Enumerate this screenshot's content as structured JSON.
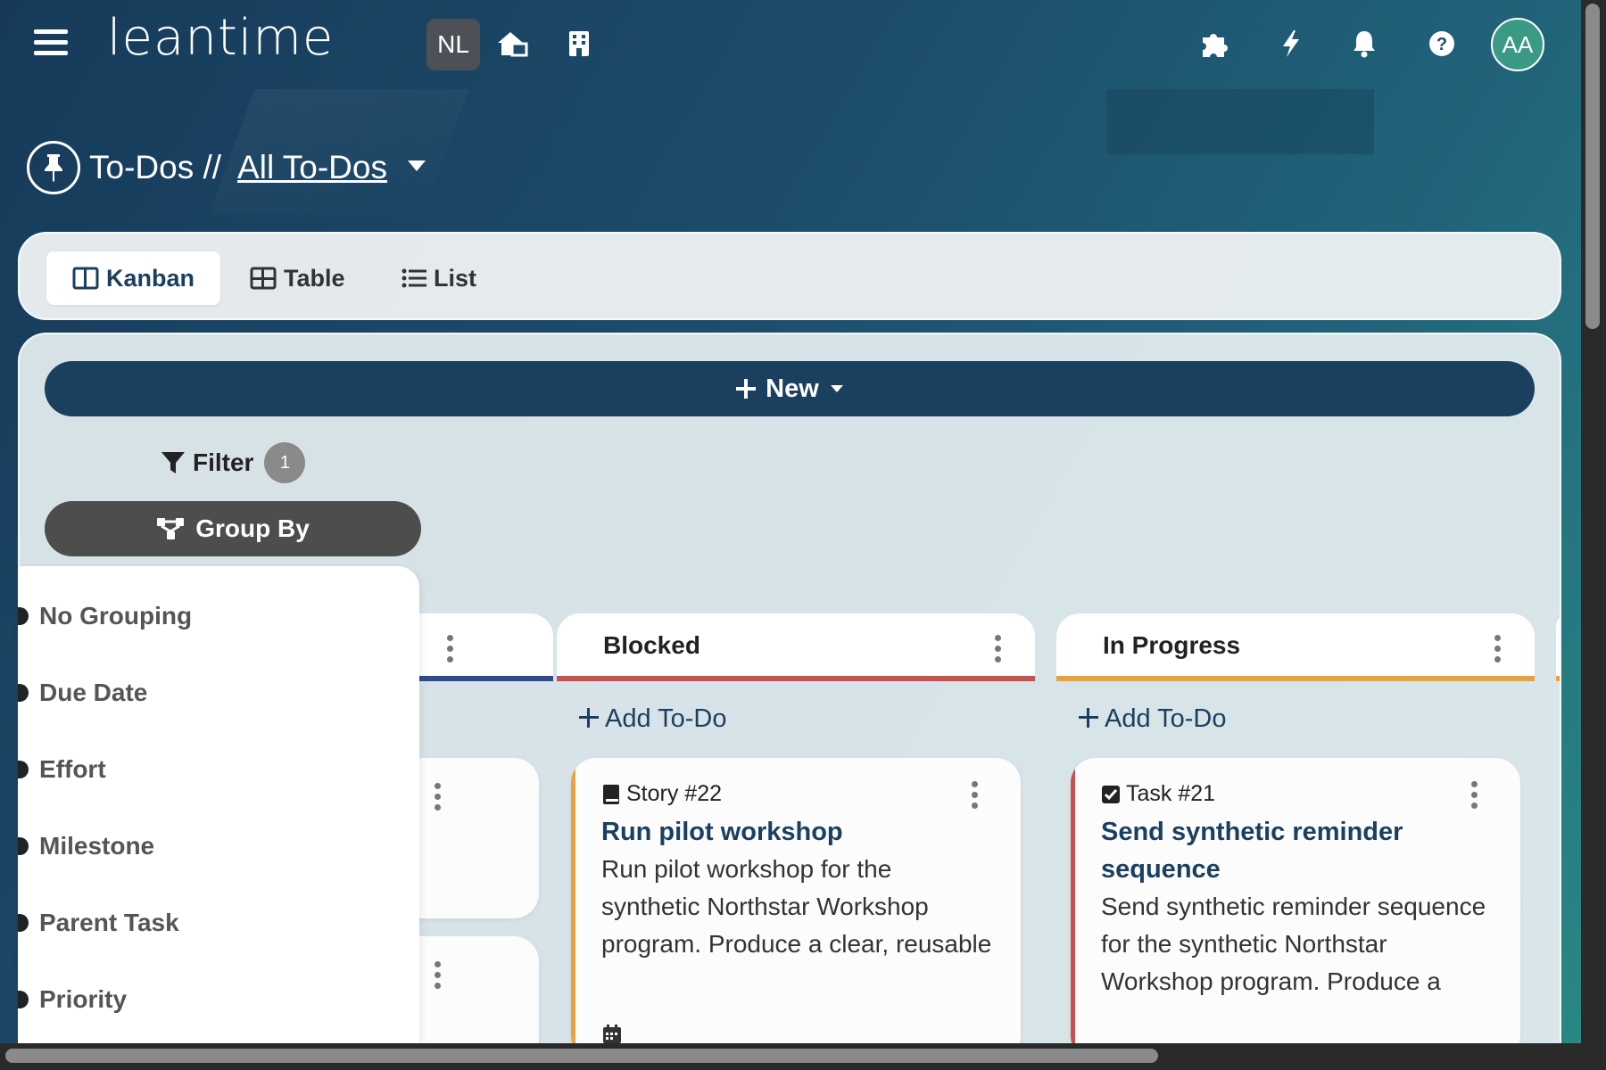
{
  "header": {
    "logo_text": "leantime",
    "project_initials": "NL",
    "user_initials": "AA",
    "icons": [
      "menu-icon",
      "home-building-icon",
      "company-building-icon",
      "puzzle-icon",
      "bolt-icon",
      "bell-icon",
      "help-icon"
    ]
  },
  "page": {
    "title_prefix": "To-Dos //",
    "title_link": "All To-Dos"
  },
  "view_tabs": [
    {
      "label": "Kanban",
      "active": true
    },
    {
      "label": "Table",
      "active": false
    },
    {
      "label": "List",
      "active": false
    }
  ],
  "toolbar": {
    "new_label": "New",
    "filter_label": "Filter",
    "filter_count": "1",
    "group_by_label": "Group By"
  },
  "group_by_options": [
    "No Grouping",
    "Due Date",
    "Effort",
    "Milestone",
    "Parent Task",
    "Priority"
  ],
  "columns": [
    {
      "name": "",
      "color": "#2f4a8f"
    },
    {
      "name": "Blocked",
      "color": "#c9514f"
    },
    {
      "name": "In Progress",
      "color": "#e8a33d"
    }
  ],
  "add_todo_label": "Add To-Do",
  "cards": [
    {
      "type": "Story #22",
      "title": "Run pilot workshop",
      "description": "Run pilot workshop for the synthetic Northstar Workshop program. Produce a clear, reusable artifact for Demo Cooperative and",
      "edge_color": "#e8a33d"
    },
    {
      "type": "Task #21",
      "title": "Send synthetic reminder sequence",
      "description": "Send synthetic reminder sequence for the synthetic Northstar Workshop program. Produce a clear, reusable artifact for Demo",
      "edge_color": "#c9514f"
    }
  ],
  "colors": {
    "brand": "#1b3f5e",
    "blocked": "#c9514f",
    "in_progress": "#e8a33d",
    "new_column": "#2f4a8f"
  }
}
